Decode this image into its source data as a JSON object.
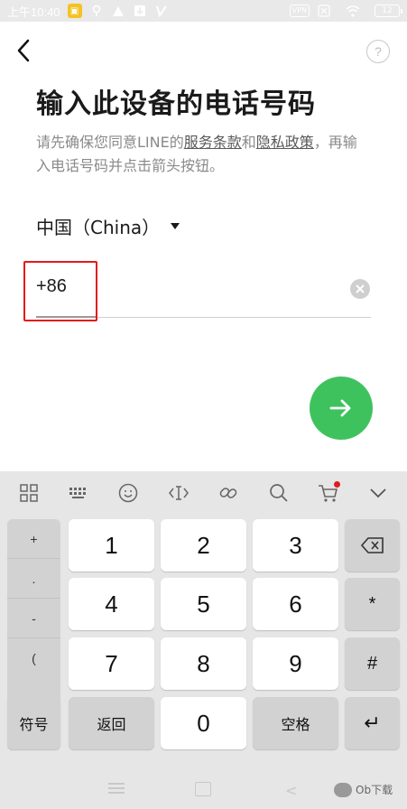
{
  "status_bar": {
    "time": "上午10:40",
    "vpn": "VPN",
    "battery": "12"
  },
  "header": {
    "help": "?"
  },
  "title": "输入此设备的电话号码",
  "description": {
    "prefix": "请先确保您同意LINE的",
    "terms_link": "服务条款",
    "and": "和",
    "privacy_link": "隐私政策",
    "suffix": "，再输入电话号码并点击箭头按钮。"
  },
  "country": {
    "selected": "中国（China）"
  },
  "phone": {
    "country_code": "+86",
    "number": ""
  },
  "keyboard": {
    "symbols": [
      "+",
      ".",
      "-",
      "("
    ],
    "digits": [
      "1",
      "2",
      "3",
      "4",
      "5",
      "6",
      "7",
      "8",
      "9",
      "0"
    ],
    "star": "*",
    "hash": "#",
    "symbol_key": "符号",
    "return_key": "返回",
    "space_key": "空格",
    "enter_key": "↵"
  },
  "watermark": "Ob下载"
}
